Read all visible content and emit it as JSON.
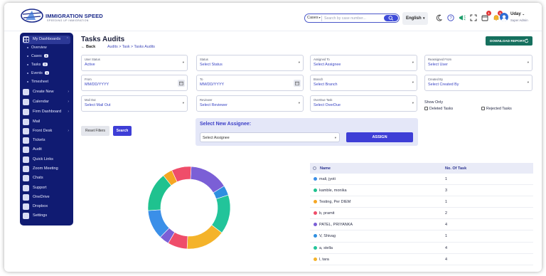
{
  "header": {
    "brand": "IMMIGRATION SPEED",
    "tagline": "SPEEDING UP IMMIGRATION",
    "search_scope": "Cases",
    "search_placeholder": "Search by case number...",
    "language": "English",
    "notification_badges": [
      "1",
      "3",
      "5"
    ],
    "user_name": "Uday",
    "user_role": "Super Admin"
  },
  "sidebar": {
    "items": [
      {
        "label": "My Dashboards",
        "icon": "dashboard-icon"
      },
      {
        "label": "Create New",
        "icon": "plus-icon"
      },
      {
        "label": "Calendar",
        "icon": "calendar-icon"
      },
      {
        "label": "Firm Dashboard",
        "icon": "building-icon"
      },
      {
        "label": "Mail",
        "icon": "mail-icon"
      },
      {
        "label": "Front Desk",
        "icon": "desk-icon"
      },
      {
        "label": "Tickets",
        "icon": "ticket-icon"
      },
      {
        "label": "Audit",
        "icon": "audit-icon"
      },
      {
        "label": "Quick Links",
        "icon": "link-icon"
      },
      {
        "label": "Zoom Meeting",
        "icon": "video-icon"
      },
      {
        "label": "Chats",
        "icon": "chat-icon"
      },
      {
        "label": "Support",
        "icon": "support-icon"
      },
      {
        "label": "OneDrive",
        "icon": "cloud-icon"
      },
      {
        "label": "Dropbox",
        "icon": "dropbox-icon"
      },
      {
        "label": "Settings",
        "icon": "gear-icon"
      }
    ],
    "subitems": [
      {
        "label": "Overview",
        "count": ""
      },
      {
        "label": "Cases",
        "count": "3"
      },
      {
        "label": "Tasks",
        "count": "3"
      },
      {
        "label": "Events",
        "count": "1"
      },
      {
        "label": "Timesheet",
        "count": ""
      }
    ]
  },
  "page": {
    "title": "Tasks Audits",
    "back": "Back",
    "breadcrumb": "Audits > Task > Tasks Audits",
    "download_label": "DOWNLOAD REPORT"
  },
  "filters": {
    "user_status": {
      "label": "User Status",
      "value": "Active"
    },
    "status": {
      "label": "Status",
      "value": "Select Status"
    },
    "assigned_to": {
      "label": "Assigned To",
      "value": "Select Assignee"
    },
    "reassigned_from": {
      "label": "Reassigned From",
      "value": "Select User"
    },
    "from": {
      "label": "From",
      "value": "MM/DD/YYYY"
    },
    "to": {
      "label": "To",
      "value": "MM/DD/YYYY"
    },
    "branch": {
      "label": "Branch",
      "value": "Select Branch"
    },
    "created_by": {
      "label": "Created By",
      "value": "Select Created By"
    },
    "mail_out": {
      "label": "Mail Out",
      "value": "Select Mail Out"
    },
    "reviewer": {
      "label": "Reviewer",
      "value": "Select Reviewer"
    },
    "overdue_task": {
      "label": "OverDue Task",
      "value": "Select OverDue"
    },
    "show_only": "Show Only",
    "deleted_tasks": "Deleted Tasks",
    "rejected_tasks": "Rejected Tasks",
    "reset_label": "Reset Filters",
    "search_label": "Search"
  },
  "assign": {
    "title": "Select New Assignee:",
    "select_value": "Select Assignee",
    "button": "ASSIGN"
  },
  "table": {
    "col_name": "Name",
    "col_count": "No. Of Task",
    "rows": [
      {
        "name": "mali, jyoti",
        "count": "1",
        "color": "#3b8fe8"
      },
      {
        "name": "kamble, monika",
        "count": "3",
        "color": "#1fc28f"
      },
      {
        "name": "Testing, Per DIEM",
        "count": "1",
        "color": "#f5a623"
      },
      {
        "name": "b, pramit",
        "count": "2",
        "color": "#ef4d6a"
      },
      {
        "name": "PATEL, PRIYANKA",
        "count": "4",
        "color": "#7b5fd6"
      },
      {
        "name": "V, Shivag",
        "count": "1",
        "color": "#2f8fe0"
      },
      {
        "name": "a, stella",
        "count": "4",
        "color": "#22c49a"
      },
      {
        "name": "l, tara",
        "count": "4",
        "color": "#f4b32a"
      }
    ]
  },
  "chart_data": {
    "type": "pie",
    "title": "",
    "slices": [
      {
        "value": 4,
        "color": "#7b5fd6"
      },
      {
        "value": 1,
        "color": "#2f8fe0"
      },
      {
        "value": 4,
        "color": "#22c49a"
      },
      {
        "value": 4,
        "color": "#f4b32a"
      },
      {
        "value": 2,
        "color": "#ef4d6a"
      },
      {
        "value": 1,
        "color": "#7b5fd6"
      },
      {
        "value": 3,
        "color": "#3b8fe8"
      },
      {
        "value": 4,
        "color": "#1fc28f"
      },
      {
        "value": 1,
        "color": "#f5a623"
      },
      {
        "value": 2,
        "color": "#ef4d6a"
      }
    ]
  }
}
